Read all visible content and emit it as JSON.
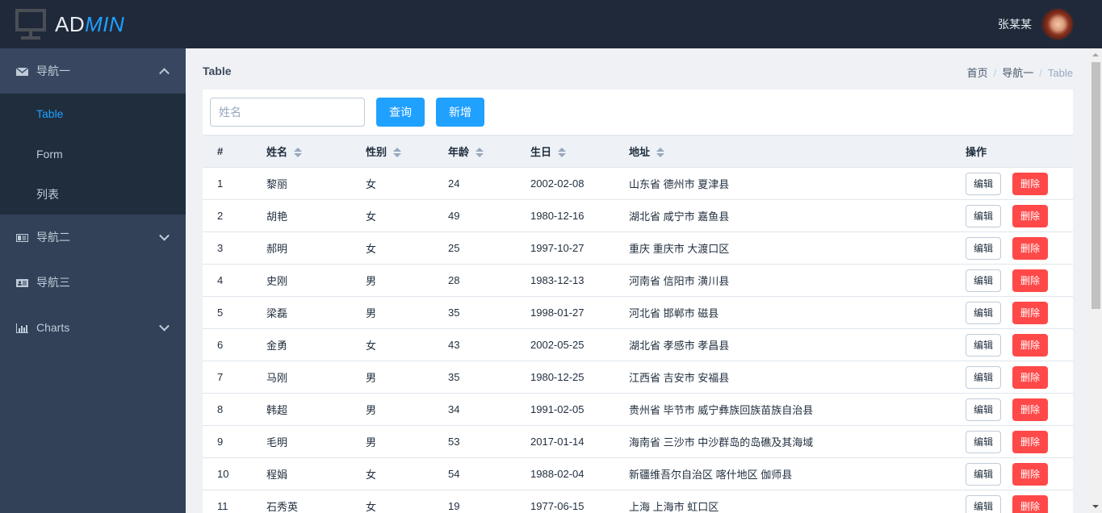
{
  "header": {
    "logo_main": "AD",
    "logo_accent": "MIN",
    "user_name": "张某某",
    "logo_icon": "monitor-icon",
    "avatar": "user-avatar"
  },
  "sidebar": {
    "groups": [
      {
        "label": "导航一",
        "icon": "envelope-icon",
        "expanded": true,
        "children": [
          {
            "label": "Table",
            "active": true
          },
          {
            "label": "Form",
            "active": false
          },
          {
            "label": "列表",
            "active": false
          }
        ]
      },
      {
        "label": "导航二",
        "icon": "id-card-icon",
        "expanded": false
      },
      {
        "label": "导航三",
        "icon": "address-card-icon",
        "expanded": false,
        "no_chevron": true
      },
      {
        "label": "Charts",
        "icon": "bar-chart-icon",
        "expanded": false
      }
    ]
  },
  "page": {
    "title": "Table",
    "breadcrumb": [
      "首页",
      "导航一",
      "Table"
    ],
    "breadcrumb_sep": "/"
  },
  "toolbar": {
    "search_placeholder": "姓名",
    "search_value": "",
    "query_label": "查询",
    "add_label": "新增"
  },
  "table": {
    "columns": [
      {
        "label": "#",
        "sortable": false
      },
      {
        "label": "姓名",
        "sortable": true
      },
      {
        "label": "性别",
        "sortable": true
      },
      {
        "label": "年龄",
        "sortable": true
      },
      {
        "label": "生日",
        "sortable": true
      },
      {
        "label": "地址",
        "sortable": true
      },
      {
        "label": "操作",
        "sortable": false
      }
    ],
    "edit_label": "编辑",
    "delete_label": "删除",
    "rows": [
      {
        "index": "1",
        "name": "黎丽",
        "gender": "女",
        "age": "24",
        "birthday": "2002-02-08",
        "address": "山东省 德州市 夏津县"
      },
      {
        "index": "2",
        "name": "胡艳",
        "gender": "女",
        "age": "49",
        "birthday": "1980-12-16",
        "address": "湖北省 咸宁市 嘉鱼县"
      },
      {
        "index": "3",
        "name": "郝明",
        "gender": "女",
        "age": "25",
        "birthday": "1997-10-27",
        "address": "重庆 重庆市 大渡口区"
      },
      {
        "index": "4",
        "name": "史刚",
        "gender": "男",
        "age": "28",
        "birthday": "1983-12-13",
        "address": "河南省 信阳市 潢川县"
      },
      {
        "index": "5",
        "name": "梁磊",
        "gender": "男",
        "age": "35",
        "birthday": "1998-01-27",
        "address": "河北省 邯郸市 磁县"
      },
      {
        "index": "6",
        "name": "金勇",
        "gender": "女",
        "age": "43",
        "birthday": "2002-05-25",
        "address": "湖北省 孝感市 孝昌县"
      },
      {
        "index": "7",
        "name": "马刚",
        "gender": "男",
        "age": "35",
        "birthday": "1980-12-25",
        "address": "江西省 吉安市 安福县"
      },
      {
        "index": "8",
        "name": "韩超",
        "gender": "男",
        "age": "34",
        "birthday": "1991-02-05",
        "address": "贵州省 毕节市 威宁彝族回族苗族自治县"
      },
      {
        "index": "9",
        "name": "毛明",
        "gender": "男",
        "age": "53",
        "birthday": "2017-01-14",
        "address": "海南省 三沙市 中沙群岛的岛礁及其海域"
      },
      {
        "index": "10",
        "name": "程娟",
        "gender": "女",
        "age": "54",
        "birthday": "1988-02-04",
        "address": "新疆维吾尔自治区 喀什地区 伽师县"
      },
      {
        "index": "11",
        "name": "石秀英",
        "gender": "女",
        "age": "19",
        "birthday": "1977-06-15",
        "address": "上海 上海市 虹口区"
      }
    ]
  },
  "colors": {
    "topbar": "#20293a",
    "sidebar": "#324157",
    "submenu": "#1f2d3d",
    "accent": "#20a0ff",
    "danger": "#ff4949"
  }
}
